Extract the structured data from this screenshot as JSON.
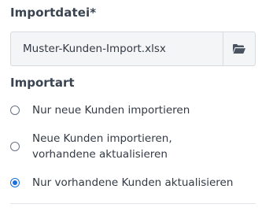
{
  "file_import": {
    "label": "Importdatei*",
    "value": "Muster-Kunden-Import.xlsx",
    "browse_icon": "folder-open-icon"
  },
  "import_type": {
    "label": "Importart",
    "options": [
      {
        "label_line1": "Nur neue Kunden importieren",
        "label_line2": "",
        "checked": false
      },
      {
        "label_line1": "Neue Kunden importieren,",
        "label_line2": "vorhandene aktualisieren",
        "checked": false
      },
      {
        "label_line1": "Nur vorhandene Kunden aktualisieren",
        "label_line2": "",
        "checked": true
      }
    ]
  },
  "colors": {
    "accent": "#1a6fe0",
    "field_bg": "#f4f5f7",
    "border": "#d7dbe0"
  }
}
